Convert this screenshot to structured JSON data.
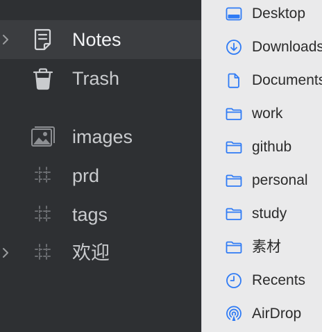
{
  "left_sidebar": {
    "items": [
      {
        "label": "Notes",
        "icon": "note-icon",
        "expandable": true,
        "selected": true
      },
      {
        "label": "Trash",
        "icon": "trash-icon",
        "expandable": false,
        "selected": false
      },
      {
        "label": "images",
        "icon": "image-icon",
        "expandable": false,
        "selected": false
      },
      {
        "label": "prd",
        "icon": "hash-icon",
        "expandable": false,
        "selected": false
      },
      {
        "label": "tags",
        "icon": "hash-icon",
        "expandable": false,
        "selected": false
      },
      {
        "label": "欢迎",
        "icon": "hash-icon",
        "expandable": true,
        "selected": false
      }
    ]
  },
  "finder_sidebar": {
    "items": [
      {
        "label": "Desktop",
        "icon": "desktop-icon"
      },
      {
        "label": "Downloads",
        "icon": "downloads-icon"
      },
      {
        "label": "Documents",
        "icon": "document-icon"
      },
      {
        "label": "work",
        "icon": "folder-icon"
      },
      {
        "label": "github",
        "icon": "folder-icon"
      },
      {
        "label": "personal",
        "icon": "folder-icon"
      },
      {
        "label": "study",
        "icon": "folder-icon"
      },
      {
        "label": "素材",
        "icon": "folder-icon"
      },
      {
        "label": "Recents",
        "icon": "clock-icon"
      },
      {
        "label": "AirDrop",
        "icon": "airdrop-icon"
      }
    ]
  },
  "colors": {
    "sidebar_bg": "#2e3033",
    "sidebar_selected_bg": "#3b3d40",
    "finder_bg": "#eaeaeb",
    "accent_blue": "#2f7bf5"
  }
}
